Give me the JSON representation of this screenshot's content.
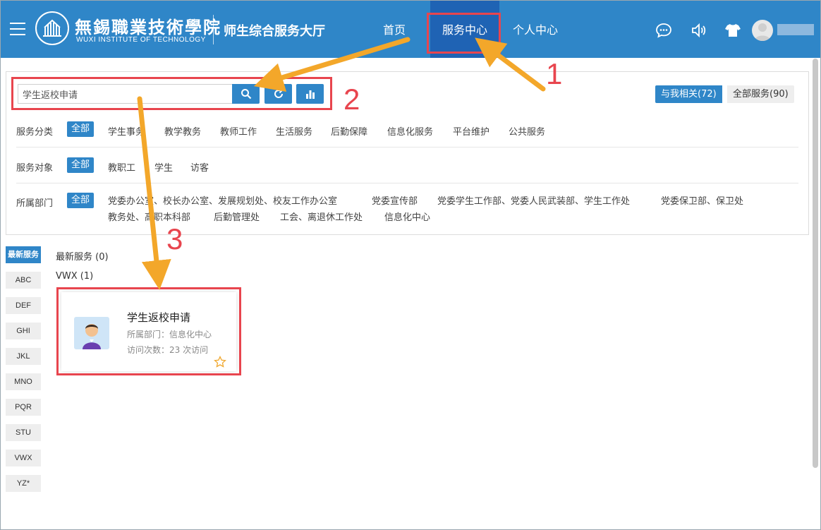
{
  "header": {
    "school_name": "無錫職業技術學院",
    "school_name_en": "WUXI INSTITUTE OF TECHNOLOGY",
    "hall_title": "师生综合服务大厅",
    "nav": [
      {
        "label": "首页"
      },
      {
        "label": "服务中心"
      },
      {
        "label": "个人中心"
      }
    ],
    "icons": [
      "chat-icon",
      "speaker-icon",
      "shirt-icon",
      "user-avatar"
    ]
  },
  "search": {
    "value": "学生返校申请",
    "placeholder": "学生返校申请"
  },
  "scope_toggle": {
    "mine": "与我相关(72)",
    "all": "全部服务(90)"
  },
  "filters": {
    "category": {
      "label": "服务分类",
      "selected": "全部",
      "options": [
        "学生事务",
        "教学教务",
        "教师工作",
        "生活服务",
        "后勤保障",
        "信息化服务",
        "平台维护",
        "公共服务"
      ]
    },
    "audience": {
      "label": "服务对象",
      "selected": "全部",
      "options": [
        "教职工",
        "学生",
        "访客"
      ]
    },
    "department": {
      "label": "所属部门",
      "selected": "全部",
      "options_row1": [
        "党委办公室、校长办公室、发展规划处、校友工作办公室",
        "党委宣传部",
        "党委学生工作部、党委人民武装部、学生工作处",
        "党委保卫部、保卫处"
      ],
      "options_row2": [
        "教务处、高职本科部",
        "后勤管理处",
        "工会、离退休工作处",
        "信息化中心"
      ]
    }
  },
  "sidebar": {
    "items": [
      "最新服务",
      "ABC",
      "DEF",
      "GHI",
      "JKL",
      "MNO",
      "PQR",
      "STU",
      "VWX",
      "YZ*"
    ]
  },
  "groups": {
    "latest": "最新服务 (0)",
    "vwx": "VWX (1)"
  },
  "card": {
    "title": "学生返校申请",
    "dept": "所属部门：信息化中心",
    "visits": "访问次数：23 次访问"
  },
  "annotations": {
    "n1": "1",
    "n2": "2",
    "n3": "3"
  },
  "colors": {
    "primary": "#2f86c8",
    "active_nav": "#1f63b4",
    "annotation_red": "#e8454e",
    "annotation_arrow": "#f3a72a"
  }
}
